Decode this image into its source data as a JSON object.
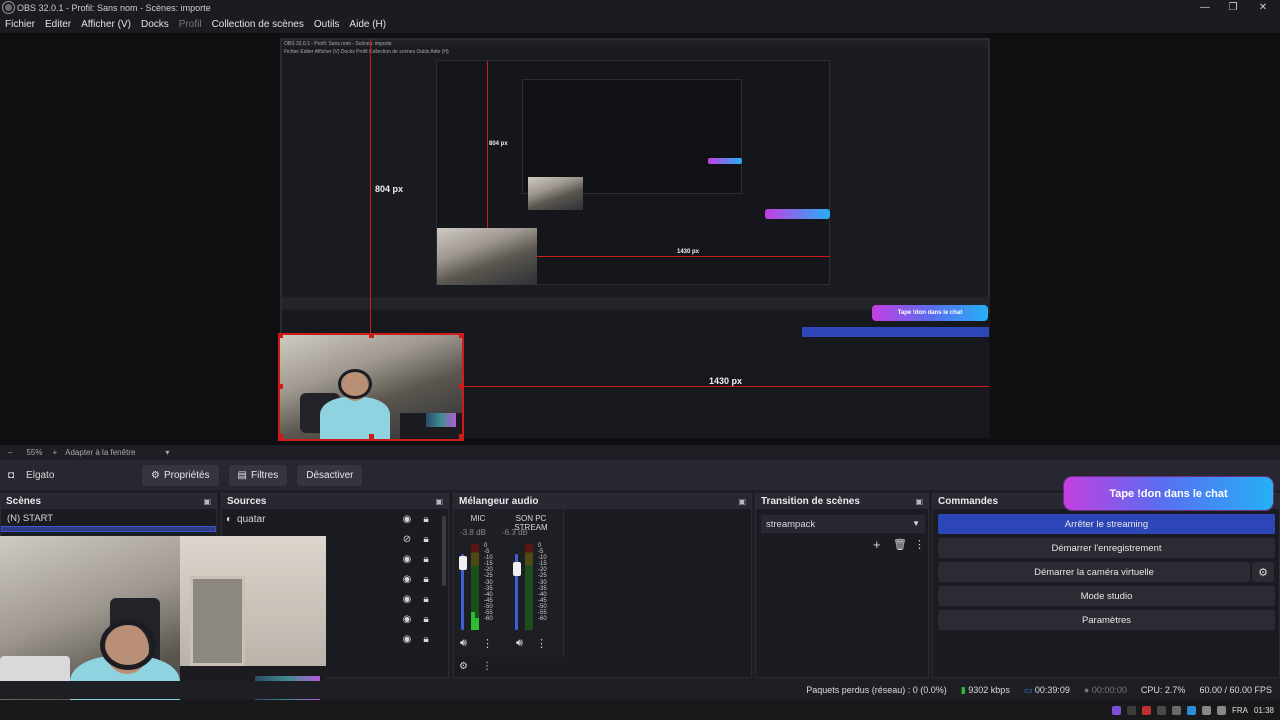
{
  "window": {
    "title": "OBS 32.0.1 - Profil: Sans nom - Scènes: importe"
  },
  "menu": [
    "Fichier",
    "Editer",
    "Afficher (V)",
    "Docks",
    "Profil",
    "Collection de scènes",
    "Outils",
    "Aide (H)"
  ],
  "preview": {
    "nested_title": "OBS 32.0.1 - Profil: Sans nom - Scènes: importe",
    "nested_menu": "Fichier   Editer   Afficher (V)   Docks   Profil   Collection de scènes   Outils   Aide (H)",
    "guide_v_label": "804 px",
    "guide_h_label": "1430 px",
    "nested_guide_v_label": "804 px",
    "nested_guide_h_label": "1430 px",
    "nested_donate": "Tape !don dans le chat"
  },
  "zoom": {
    "minus": "–",
    "value": "55%",
    "plus": "+",
    "fit": "Adapter à la fenêtre"
  },
  "source_bar": {
    "source_name": "Elgato",
    "properties": "Propriétés",
    "filters": "Filtres",
    "deactivate": "Désactiver"
  },
  "scenes": {
    "title": "Scènes",
    "items": [
      "(N) START"
    ]
  },
  "sources": {
    "title": "Sources",
    "items": [
      "quatar"
    ]
  },
  "mixer": {
    "title": "Mélangeur audio",
    "channels": [
      {
        "name": "MIC",
        "db": "-3.8 dB"
      },
      {
        "name": "SON PC STREAM",
        "db": "-6.3 dB"
      }
    ],
    "scale": [
      "0",
      "-5",
      "-10",
      "-15",
      "-20",
      "-25",
      "-30",
      "-35",
      "-40",
      "-45",
      "-50",
      "-55",
      "-60"
    ]
  },
  "transitions": {
    "title": "Transition de scènes",
    "selected": "streampack"
  },
  "commands": {
    "title": "Commandes",
    "buttons": [
      "Arrêter le streaming",
      "Démarrer l'enregistrement",
      "Démarrer la caméra virtuelle",
      "Mode studio",
      "Paramètres"
    ]
  },
  "donate": "Tape !don dans le chat",
  "status": {
    "dropped": "Paquets perdus (réseau) : 0 (0.0%)",
    "bitrate": "9302 kbps",
    "stream_time": "00:39:09",
    "rec_time": "00:00:00",
    "cpu": "CPU: 2.7%",
    "fps": "60.00 / 60.00 FPS"
  },
  "taskbar": {
    "lang": "FRA",
    "time": "01:38"
  },
  "colors": {
    "accent": "#2d46b8",
    "guide": "#d01b1b",
    "meter": "#2fbd2f"
  }
}
